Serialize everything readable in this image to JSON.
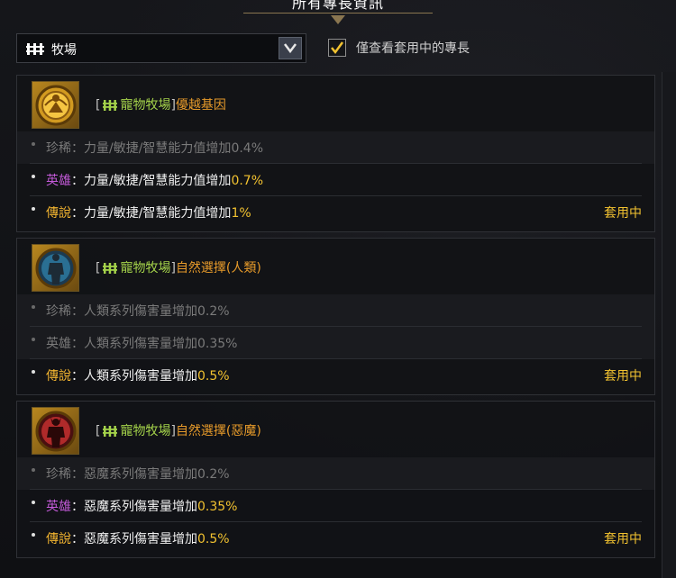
{
  "title": "所有專長資訊",
  "filter": {
    "selected": "牧場",
    "icon": "fence-icon",
    "checkbox_label": "僅查看套用中的專長",
    "checkbox_checked": true
  },
  "cards": [
    {
      "icon": "golden-gene-icon",
      "category": "寵物牧場",
      "name": "優越基因",
      "rows": [
        {
          "grade": "珍稀",
          "grade_class": "rare",
          "desc": "力量/敏捷/智慧能力值增加",
          "value": "0.4%",
          "dim": true,
          "applied": ""
        },
        {
          "grade": "英雄",
          "grade_class": "hero",
          "desc": "力量/敏捷/智慧能力值增加",
          "value": "0.7%",
          "dim": false,
          "applied": ""
        },
        {
          "grade": "傳說",
          "grade_class": "legend",
          "desc": "力量/敏捷/智慧能力值增加",
          "value": "1%",
          "dim": false,
          "applied": "套用中"
        }
      ]
    },
    {
      "icon": "human-figure-icon",
      "category": "寵物牧場",
      "name": "自然選擇(人類)",
      "rows": [
        {
          "grade": "珍稀",
          "grade_class": "rare",
          "desc": "人類系列傷害量增加",
          "value": "0.2%",
          "dim": true,
          "applied": ""
        },
        {
          "grade": "英雄",
          "grade_class": "hero",
          "desc": "人類系列傷害量增加",
          "value": "0.35%",
          "dim": true,
          "applied": ""
        },
        {
          "grade": "傳說",
          "grade_class": "legend",
          "desc": "人類系列傷害量增加",
          "value": "0.5%",
          "dim": false,
          "applied": "套用中"
        }
      ]
    },
    {
      "icon": "demon-figure-icon",
      "category": "寵物牧場",
      "name": "自然選擇(惡魔)",
      "rows": [
        {
          "grade": "珍稀",
          "grade_class": "rare",
          "desc": "惡魔系列傷害量增加",
          "value": "0.2%",
          "dim": true,
          "applied": ""
        },
        {
          "grade": "英雄",
          "grade_class": "hero",
          "desc": "惡魔系列傷害量增加",
          "value": "0.35%",
          "dim": false,
          "applied": ""
        },
        {
          "grade": "傳說",
          "grade_class": "legend",
          "desc": "惡魔系列傷害量增加",
          "value": "0.5%",
          "dim": false,
          "applied": "套用中"
        }
      ]
    }
  ]
}
